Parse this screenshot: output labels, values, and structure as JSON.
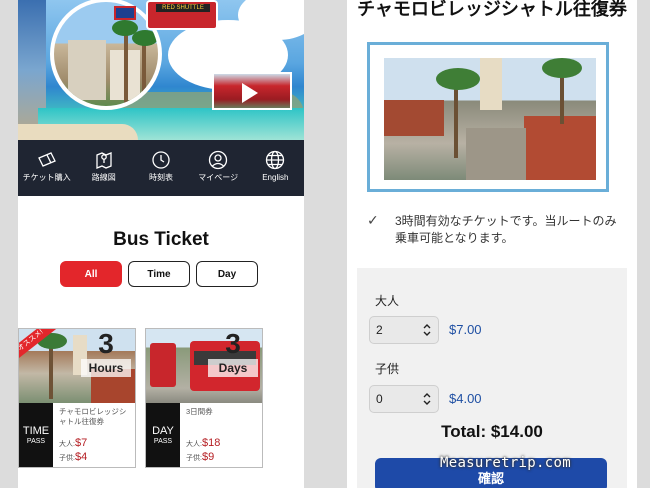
{
  "left": {
    "hero_bus_sign": "RED SHUTTLE",
    "nav": [
      {
        "label": "チケット購入",
        "icon": "ticket-icon"
      },
      {
        "label": "路線図",
        "icon": "map-icon"
      },
      {
        "label": "時刻表",
        "icon": "clock-icon"
      },
      {
        "label": "マイページ",
        "icon": "user-icon"
      },
      {
        "label": "English",
        "icon": "globe-icon"
      }
    ],
    "section_title": "Bus Ticket",
    "filters": [
      {
        "label": "All",
        "active": true
      },
      {
        "label": "Time",
        "active": false
      },
      {
        "label": "Day",
        "active": false
      }
    ],
    "cards": [
      {
        "ribbon": "オススメ!",
        "count": "3",
        "unit": "Hours",
        "pass_kind": "TIME",
        "pass_sub": "PASS",
        "name": "チャモロビレッジシャトル往復券",
        "adult_label": "大人:",
        "adult_price": "$7",
        "child_label": "子供:",
        "child_price": "$4"
      },
      {
        "count": "3",
        "unit": "Days",
        "pass_kind": "DAY",
        "pass_sub": "PASS",
        "name": "3日間券",
        "adult_label": "大人:",
        "adult_price": "$18",
        "child_label": "子供:",
        "child_price": "$9"
      }
    ]
  },
  "right": {
    "title": "チャモロビレッジシャトル往復券",
    "description": "3時間有効なチケットです。当ルートのみ乗車可能となります。",
    "adult_label": "大人",
    "adult_qty": "2",
    "adult_price": "$7.00",
    "child_label": "子供",
    "child_qty": "0",
    "child_price": "$4.00",
    "total": "Total: $14.00",
    "confirm_label": "確認"
  },
  "watermark": "Measuretrip.com",
  "colors": {
    "accent_red": "#e3262b",
    "nav_bg": "#1f2532",
    "button_blue": "#1e4aa8",
    "price_blue": "#1e4fa3",
    "frame_blue": "#6aaed8"
  }
}
